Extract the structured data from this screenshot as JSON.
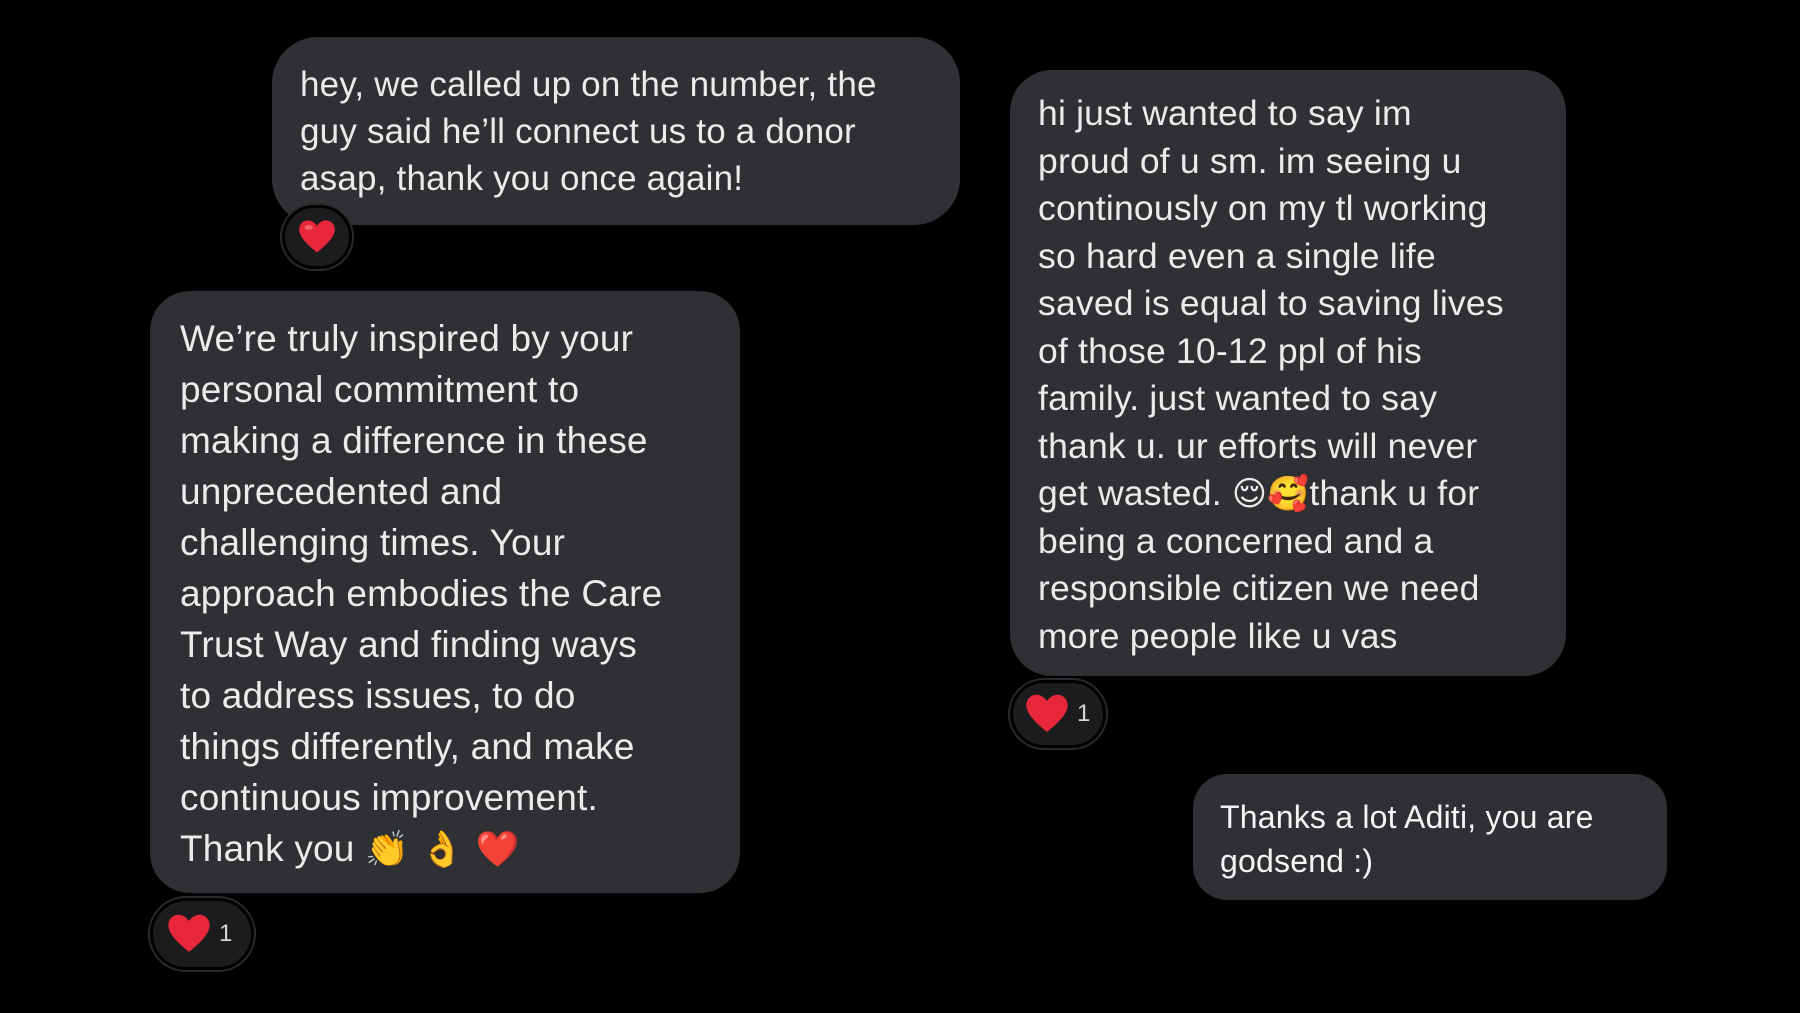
{
  "messages": [
    {
      "text": "hey, we called up on the number, the\nguy said he’ll connect us to a donor\nasap, thank you once again!",
      "reaction": "❤️"
    },
    {
      "text": "We’re truly inspired by your\npersonal commitment to\nmaking a difference in these\nunprecedented and\nchallenging times. Your\napproach embodies the Care\nTrust Way and finding ways\nto address issues, to do\nthings differently,  and make\ncontinuous improvement.\nThank you",
      "trailing_emoji": "👏 👌 ❤️",
      "reaction": "❤️",
      "reaction_count": "1"
    },
    {
      "text": "hi just wanted to say im\nproud of u sm. im seeing u\ncontinously on my tl working\nso hard even a single life\nsaved is equal to saving lives\nof those 10-12 ppl of his\nfamily. just wanted to say\nthank u. ur efforts will never\nget wasted. ",
      "inline_emoji": "😌🥰",
      "text_after": "thank u for\nbeing a concerned and a\nresponsible citizen we need\nmore people like u vas",
      "reaction": "❤️",
      "reaction_count": "1"
    },
    {
      "text": "Thanks a lot Aditi, you are\ngodsend :)"
    }
  ],
  "colors": {
    "background": "#000000",
    "bubble": "#2f3033",
    "text": "#ecebea",
    "heart": "#e8283a"
  }
}
